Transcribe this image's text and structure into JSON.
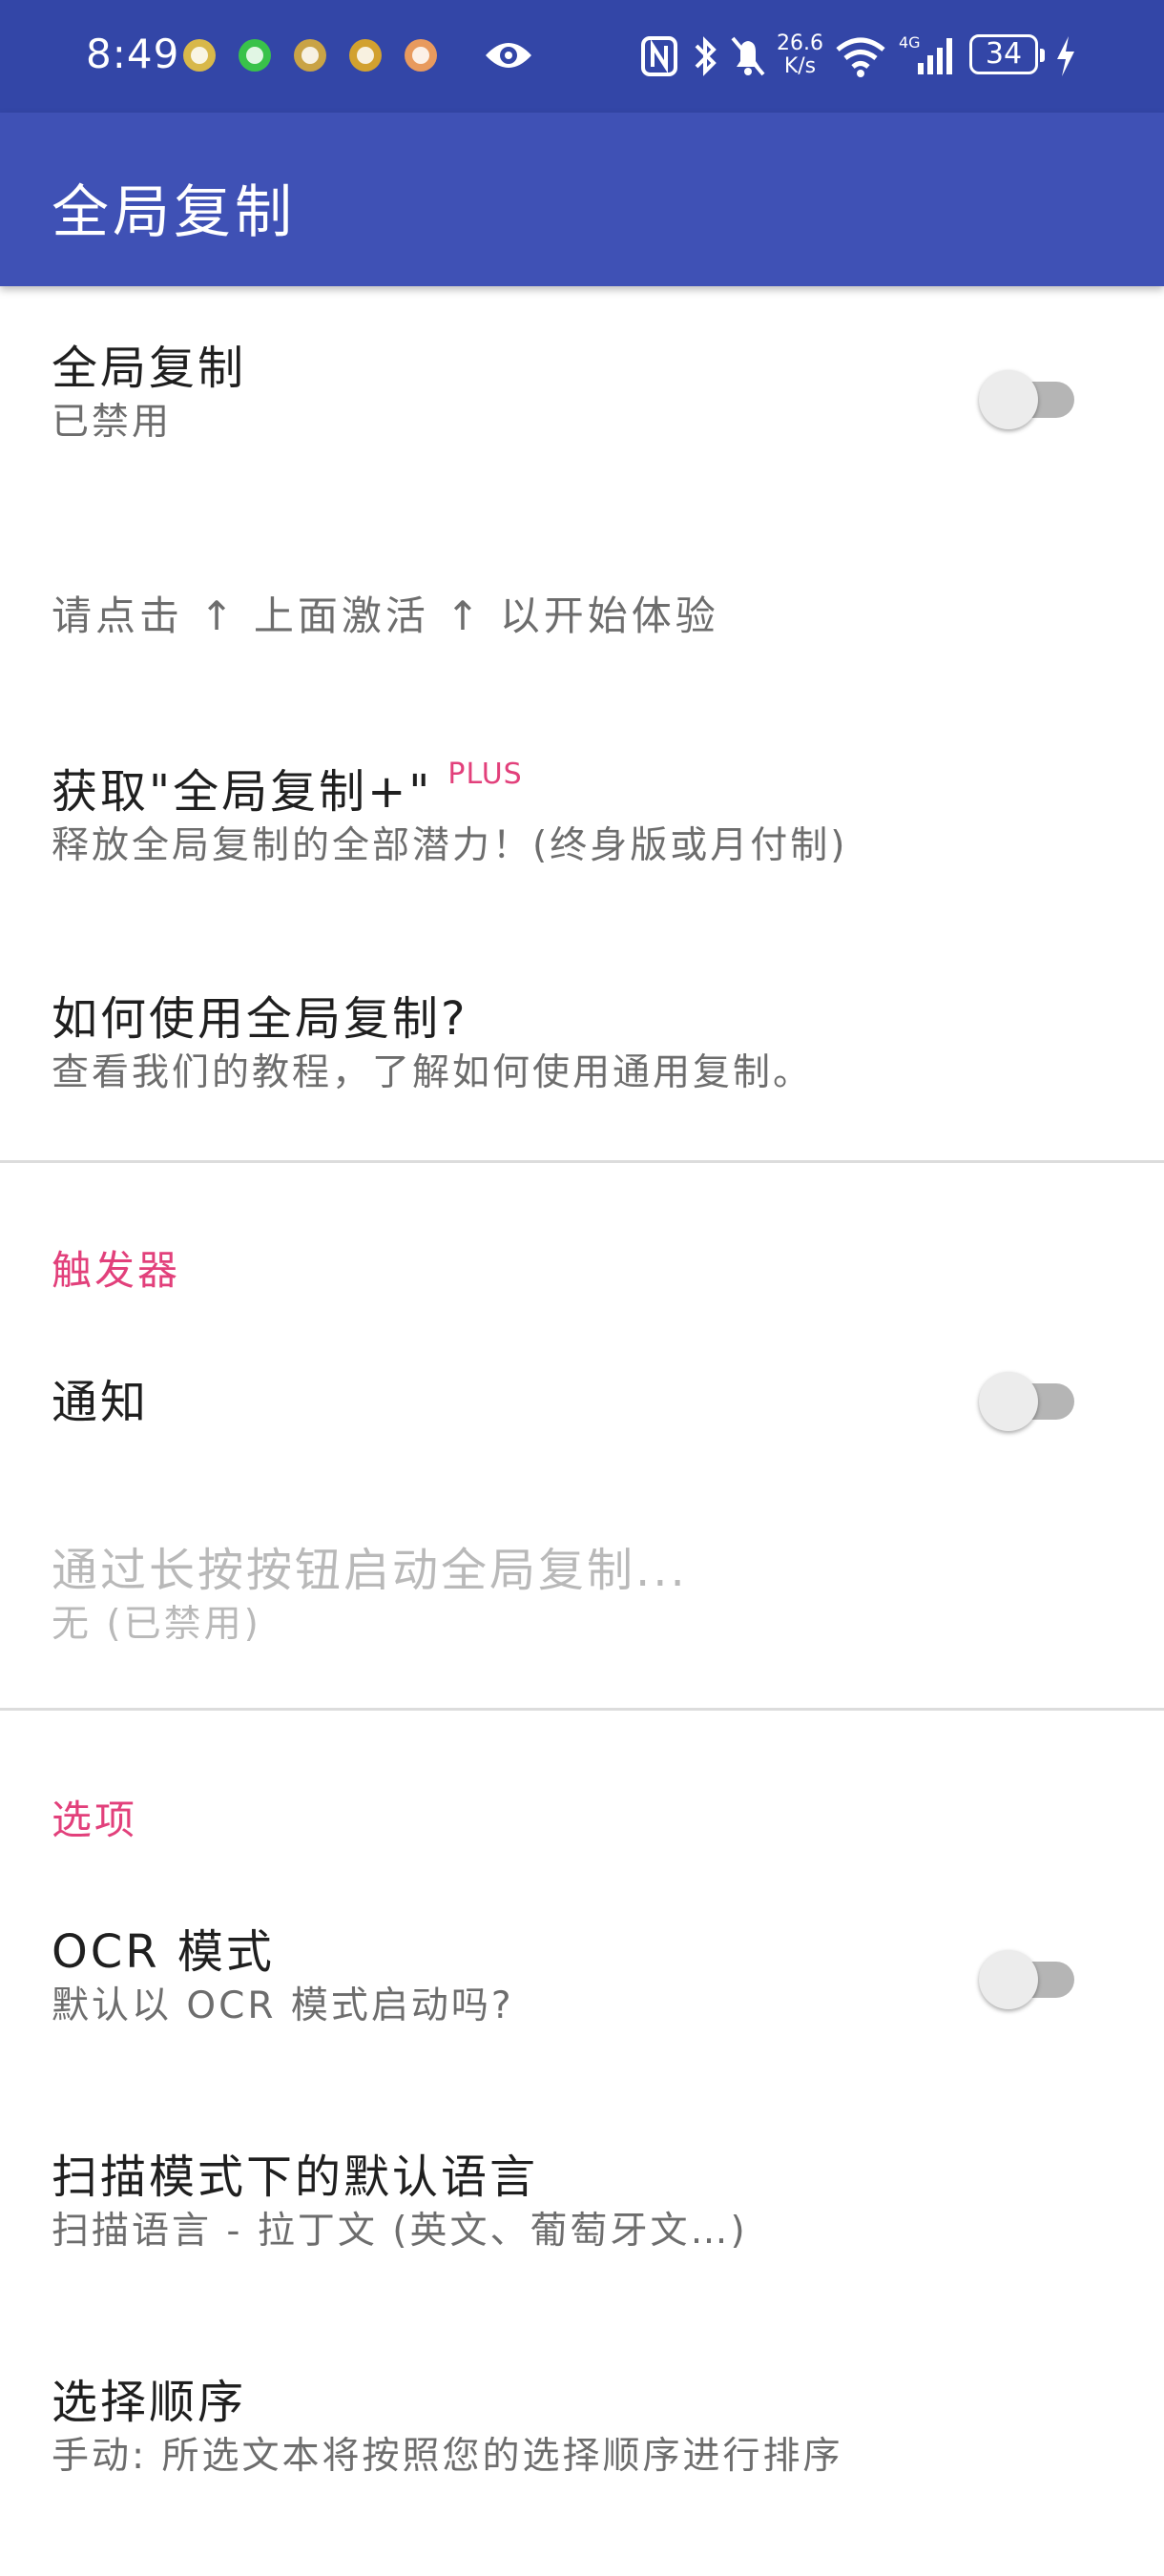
{
  "status_bar": {
    "time": "8:49",
    "net_speed_value": "26.6",
    "net_speed_unit": "K/s",
    "battery": "34",
    "icons": [
      "app-notification-icon",
      "app-notification-icon",
      "app-notification-icon",
      "app-notification-icon",
      "app-notification-icon",
      "eye-icon",
      "nfc-icon",
      "bluetooth-icon",
      "mute-icon",
      "wifi-icon",
      "signal-icon",
      "battery-icon",
      "charging-icon"
    ]
  },
  "app_bar": {
    "title": "全局复制"
  },
  "main_toggle": {
    "title": "全局复制",
    "summary": "已禁用",
    "enabled": false
  },
  "hint": "请点击 ↑ 上面激活 ↑ 以开始体验",
  "get_plus": {
    "title": "获取\"全局复制+\"",
    "badge": "PLUS",
    "summary": "释放全局复制的全部潜力！(终身版或月付制)"
  },
  "how_to": {
    "title": "如何使用全局复制?",
    "summary": "查看我们的教程，了解如何使用通用复制。"
  },
  "triggers": {
    "header": "触发器",
    "notification": {
      "title": "通知",
      "enabled": false
    },
    "long_press": {
      "title": "通过长按按钮启动全局复制...",
      "summary": "无 (已禁用)"
    }
  },
  "options": {
    "header": "选项",
    "ocr_mode": {
      "title": "OCR 模式",
      "summary": "默认以 OCR 模式启动吗?",
      "enabled": false
    },
    "scan_language": {
      "title": "扫描模式下的默认语言",
      "summary": "扫描语言 - 拉丁文 (英文、葡萄牙文…)"
    },
    "selection_order": {
      "title": "选择顺序",
      "summary": "手动: 所选文本将按照您的选择顺序进行排序"
    }
  },
  "colors": {
    "status_bar": "#3346a7",
    "app_bar": "#3f51b5",
    "accent": "#e2407b"
  }
}
